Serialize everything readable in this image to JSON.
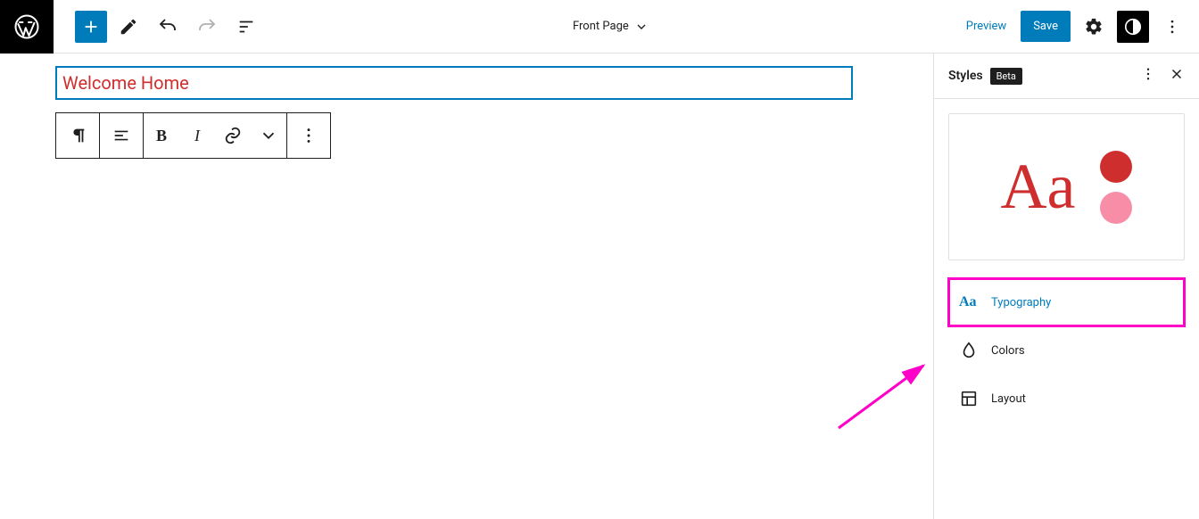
{
  "topbar": {
    "page_title": "Front Page",
    "preview": "Preview",
    "save": "Save"
  },
  "editor": {
    "heading_text": "Welcome Home"
  },
  "sidebar": {
    "title": "Styles",
    "badge": "Beta",
    "preview_letters": "Aa",
    "items": [
      {
        "label": "Typography"
      },
      {
        "label": "Colors"
      },
      {
        "label": "Layout"
      }
    ]
  }
}
